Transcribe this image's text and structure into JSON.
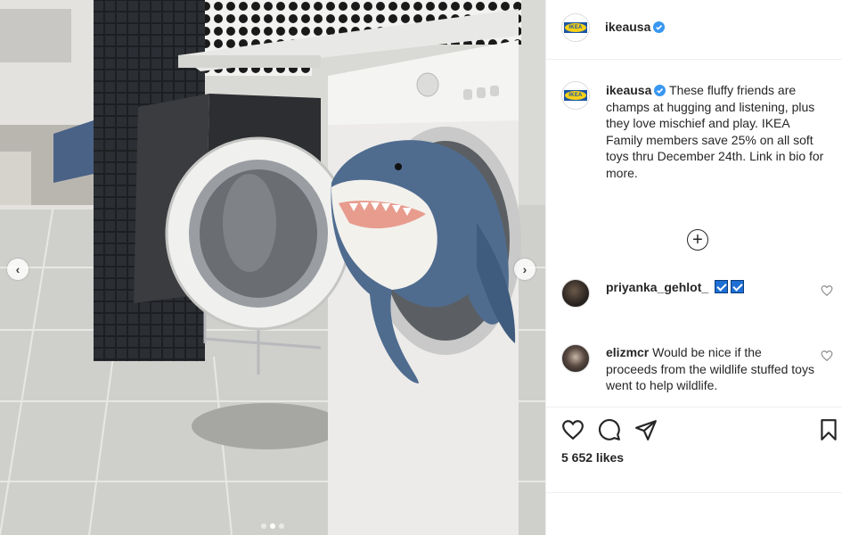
{
  "post": {
    "username": "ikeausa",
    "caption": "These fluffy friends are champs at hugging and listening, plus they love mischief and play. IKEA Family members save 25% on all soft toys thru December 24th. Link in bio for more.",
    "likes": "5 652 likes",
    "logo_text": "IKEA"
  },
  "comments": [
    {
      "username": "priyanka_gehlot_",
      "text": ""
    },
    {
      "username": "elizmcr",
      "text": "Would be nice if the proceeds from the wildlife stuffed toys went to help wildlife."
    }
  ],
  "carousel": {
    "slides": 3,
    "active": 1
  },
  "icons": {
    "prev": "chevron-left-icon",
    "next": "chevron-right-icon",
    "load_more": "plus-circle-icon",
    "like": "heart-icon",
    "comment": "comment-icon",
    "share": "paper-plane-icon",
    "save": "bookmark-icon"
  },
  "colors": {
    "verified": "#3897f0",
    "ikea_blue": "#1b55a3",
    "ikea_yellow": "#f7d117",
    "text": "#262626"
  }
}
